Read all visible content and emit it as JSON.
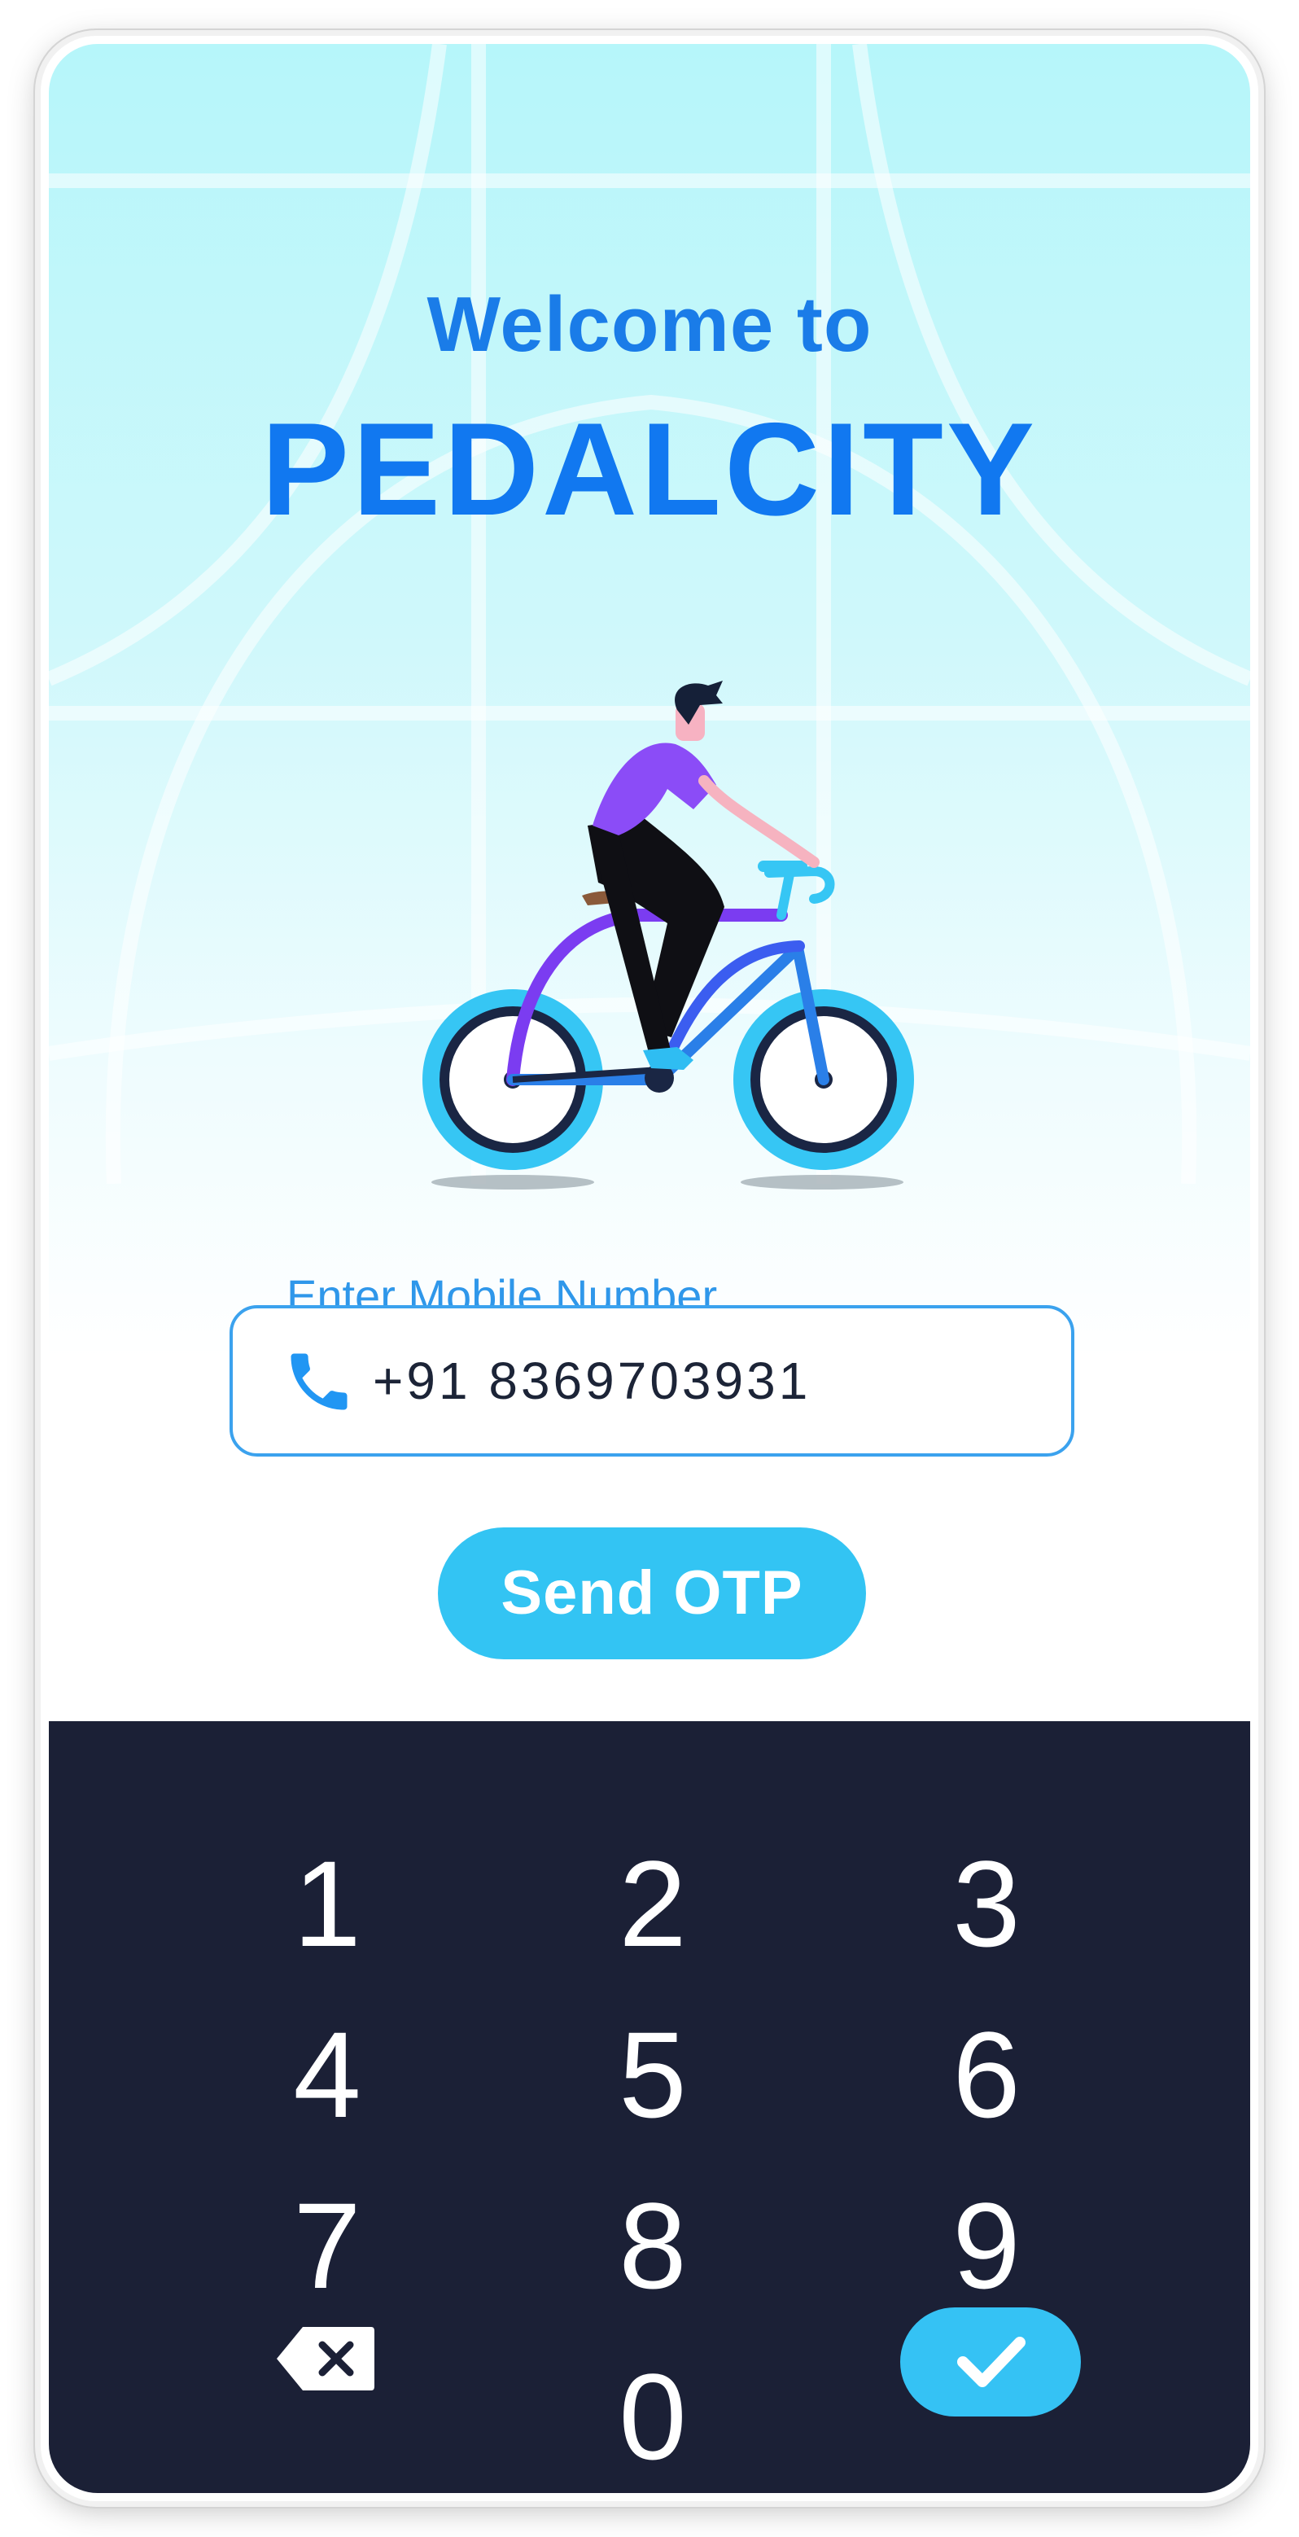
{
  "header": {
    "welcome": "Welcome to",
    "brand": "PEDALCITY"
  },
  "login": {
    "label": "Enter Mobile Number",
    "phone_value": "+91 8369703931",
    "send_button": "Send OTP"
  },
  "keypad": {
    "keys": [
      "1",
      "2",
      "3",
      "4",
      "5",
      "6",
      "7",
      "8",
      "9",
      "0"
    ],
    "backspace_icon": "backspace-icon",
    "confirm_icon": "checkmark-icon"
  },
  "colors": {
    "brand_blue": "#1178f0",
    "accent_cyan": "#33c4f3",
    "keypad_bg": "#1b2036",
    "label_blue": "#2f97ea"
  }
}
